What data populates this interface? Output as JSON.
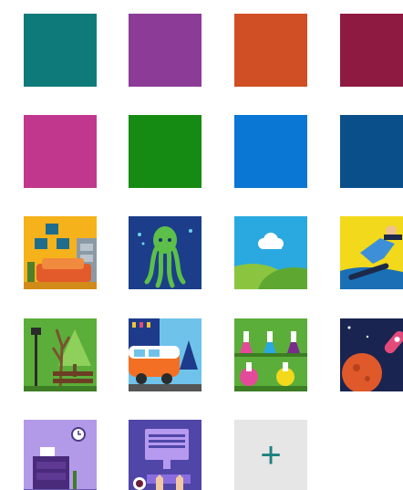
{
  "swatches": [
    {
      "color": "#0e7a7a",
      "selected": true
    },
    {
      "color": "#8c3b97"
    },
    {
      "color": "#d04f24"
    },
    {
      "color": "#8e1a42"
    },
    {
      "color": "#c2378e"
    },
    {
      "color": "#168b13"
    },
    {
      "color": "#0a77d4"
    },
    {
      "color": "#0b4f8a"
    }
  ],
  "pictures": [
    {
      "icon": "living-room-icon"
    },
    {
      "icon": "octopus-icon"
    },
    {
      "icon": "cloud-hills-icon"
    },
    {
      "icon": "snowboarder-icon"
    },
    {
      "icon": "park-bench-icon"
    },
    {
      "icon": "bus-city-icon"
    },
    {
      "icon": "lab-flasks-icon"
    },
    {
      "icon": "space-rocket-icon"
    },
    {
      "icon": "desk-clock-icon"
    },
    {
      "icon": "computer-typing-icon"
    }
  ],
  "add_tile": {
    "glyph": "+",
    "background": "#e6e6e6",
    "glyph_color": "#1e7f7f"
  }
}
